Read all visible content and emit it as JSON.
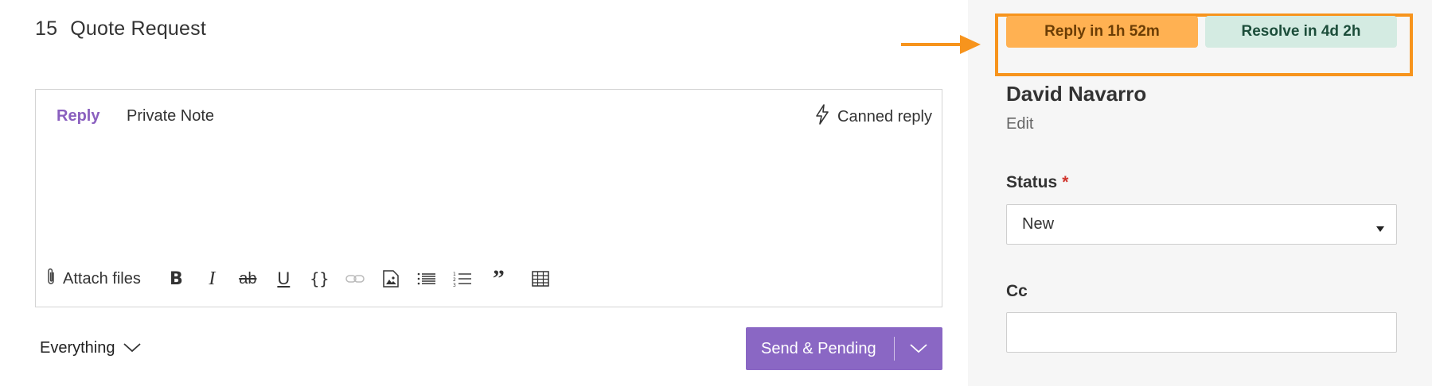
{
  "ticket": {
    "number": "15",
    "subject": "Quote Request"
  },
  "editor": {
    "tabs": {
      "reply": "Reply",
      "private_note": "Private Note"
    },
    "canned_reply": "Canned reply",
    "attach_files": "Attach files",
    "toolbar_icons": [
      "bold-icon",
      "italic-icon",
      "strikethrough-icon",
      "underline-icon",
      "code-icon",
      "link-icon",
      "image-icon",
      "bullet-list-icon",
      "numbered-list-icon",
      "quote-icon",
      "table-icon"
    ]
  },
  "filter": {
    "label": "Everything"
  },
  "send_button": {
    "label": "Send & Pending"
  },
  "sla": {
    "reply": "Reply in 1h 52m",
    "resolve": "Resolve in 4d 2h"
  },
  "contact": {
    "name": "David Navarro",
    "edit": "Edit"
  },
  "status": {
    "label": "Status",
    "required_mark": "*",
    "value": "New"
  },
  "cc": {
    "label": "Cc",
    "value": ""
  },
  "colors": {
    "accent": "#8a67c4",
    "highlight": "#f7941d",
    "sla_reply_bg": "#ffb152",
    "sla_resolve_bg": "#d4ebe2"
  }
}
